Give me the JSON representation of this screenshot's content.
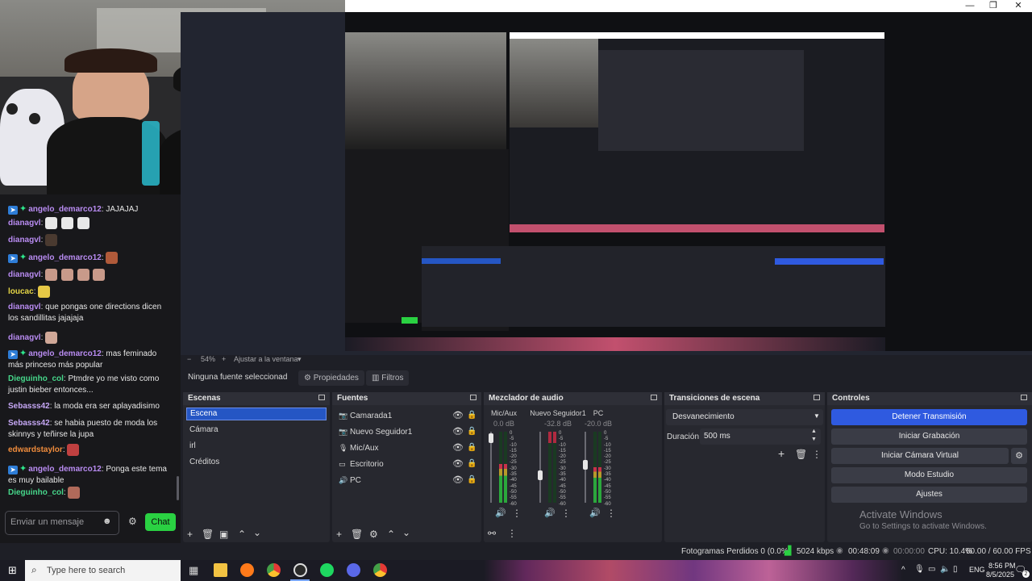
{
  "window": {
    "minimize": "—",
    "maximize": "❐",
    "close": "✕"
  },
  "chat": {
    "messages": [
      {
        "user": "angelo_demarco12",
        "color": "#b98cf2",
        "badges": true,
        "text": ": JAJAJAJ",
        "emotes": []
      },
      {
        "user": "dianagvl",
        "color": "#b98cf2",
        "badges": false,
        "text": ":",
        "emotes": [
          "#e8e8e8",
          "#e8e8e8",
          "#e8e8e8"
        ]
      },
      {
        "user": "dianagvl",
        "color": "#b98cf2",
        "badges": false,
        "text": ":",
        "emotes": [
          "#4a3a30"
        ]
      },
      {
        "user": "angelo_demarco12",
        "color": "#b98cf2",
        "badges": true,
        "text": ":",
        "emotes": [
          "#b05a3a"
        ]
      },
      {
        "user": "dianagvl",
        "color": "#b98cf2",
        "badges": false,
        "text": ":",
        "emotes": [
          "#c89a8a",
          "#c89a8a",
          "#c89a8a",
          "#c89a8a"
        ]
      },
      {
        "user": "loucac",
        "color": "#e6d646",
        "badges": false,
        "text": ":",
        "emotes": [
          "#e6c846"
        ]
      },
      {
        "user": "dianagvl",
        "color": "#b98cf2",
        "badges": false,
        "text": ": que pongas one directions dicen los sandillitas jajajaja",
        "emotes": []
      },
      {
        "user": "dianagvl",
        "color": "#b98cf2",
        "badges": false,
        "text": ":",
        "emotes": [
          "#d0a898"
        ]
      },
      {
        "user": "angelo_demarco12",
        "color": "#b98cf2",
        "badges": true,
        "text": ": mas feminado más princeso más popular",
        "emotes": []
      },
      {
        "user": "Dieguinho_col",
        "color": "#46d68a",
        "badges": false,
        "text": ": Ptmdre yo me visto como justin bieber entonces...",
        "emotes": []
      },
      {
        "user": "Sebasss42",
        "color": "#c6a8f6",
        "badges": false,
        "text": ": la moda era ser aplayadisimo",
        "emotes": []
      },
      {
        "user": "Sebasss42",
        "color": "#c6a8f6",
        "badges": false,
        "text": ": se habia puesto de moda los skinnys y teñirse la jupa",
        "emotes": []
      },
      {
        "user": "edwardstaylor",
        "color": "#f08c3c",
        "badges": false,
        "text": ":",
        "emotes": [
          "#c04040"
        ]
      },
      {
        "user": "angelo_demarco12",
        "color": "#b98cf2",
        "badges": true,
        "text": ": Ponga este tema es muy bailable",
        "emotes": []
      },
      {
        "user": "Dieguinho_col",
        "color": "#46d68a",
        "badges": false,
        "text": ":",
        "emotes": [
          "#b06a5a"
        ]
      }
    ],
    "input_placeholder": "Enviar un mensaje",
    "chat_button": "Chat"
  },
  "zoom": {
    "minus": "−",
    "level": "54%",
    "plus": "+",
    "fit": "Ajustar a la ventana"
  },
  "source_bar": {
    "none_selected": "Ninguna fuente seleccionad",
    "properties": "Propiedades",
    "filters": "Filtros"
  },
  "scenes": {
    "title": "Escenas",
    "items": [
      "Escena",
      "Cámara",
      "irl",
      "Créditos"
    ]
  },
  "sources": {
    "title": "Fuentes",
    "items": [
      "Camarada1",
      "Nuevo Seguidor1",
      "Mic/Aux",
      "Escritorio",
      "PC"
    ]
  },
  "mixer": {
    "title": "Mezclador de audio",
    "channels": [
      {
        "name": "Mic/Aux",
        "db": "0.0 dB",
        "level": 0.55
      },
      {
        "name": "Nuevo Seguidor1",
        "db": "-32.8 dB",
        "level": 0.0
      },
      {
        "name": "PC",
        "db": "-20.0 dB",
        "level": 0.5
      }
    ],
    "scale": [
      "0",
      "-5",
      "-10",
      "-15",
      "-20",
      "-25",
      "-30",
      "-35",
      "-40",
      "-45",
      "-50",
      "-55",
      "-60"
    ]
  },
  "transitions": {
    "title": "Transiciones de escena",
    "type": "Desvanecimiento",
    "duration_label": "Duración",
    "duration_value": "500 ms"
  },
  "controls": {
    "title": "Controles",
    "buttons": [
      "Detener Transmisión",
      "Iniciar Grabación",
      "Iniciar Cámara Virtual",
      "Modo Estudio",
      "Ajustes"
    ]
  },
  "watermark": {
    "title": "Activate Windows",
    "subtitle": "Go to Settings to activate Windows."
  },
  "status": {
    "dropped": "Fotogramas Perdidos 0 (0.0%)",
    "bitrate": "5024 kbps",
    "live_time": "00:48:09",
    "rec_time": "00:00:00",
    "cpu": "CPU: 10.4%",
    "fps": "60.00 / 60.00 FPS"
  },
  "taskbar": {
    "search_placeholder": "Type here to search",
    "language": "ENG",
    "time": "8:56 PM",
    "date": "8/5/2025",
    "notification_count": "2"
  },
  "colors": {
    "accent": "#2f5ae0",
    "chat_green": "#2ad142",
    "panel": "#27282f",
    "background": "#1e1f26"
  }
}
